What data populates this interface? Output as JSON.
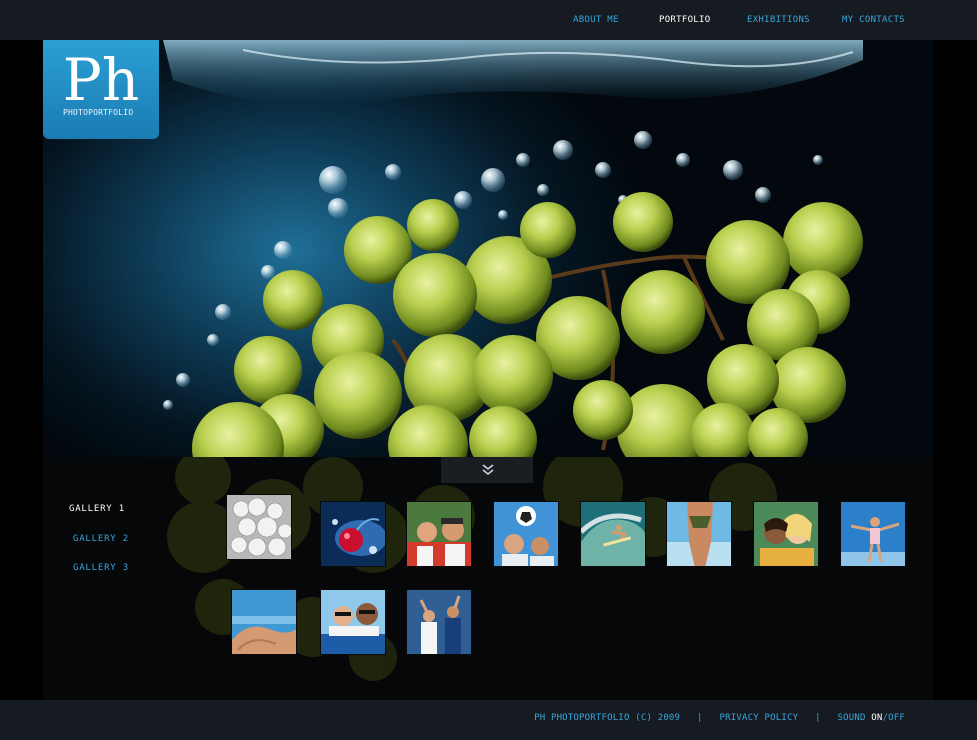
{
  "nav": {
    "items": [
      {
        "label": "ABOUT ME"
      },
      {
        "label": "PORTFOLIO"
      },
      {
        "label": "EXHIBITIONS"
      },
      {
        "label": "MY CONTACTS"
      }
    ],
    "active_label": "PORTFOLIO"
  },
  "logo": {
    "mark": "Ph",
    "subtitle": "PHOTOPORTFOLIO"
  },
  "gallery": {
    "links": [
      {
        "label": "GALLERY 1"
      },
      {
        "label": "GALLERY 2"
      },
      {
        "label": "GALLERY 3"
      }
    ],
    "active_label": "GALLERY 1"
  },
  "footer": {
    "copyright": "PH PHOTOPORTFOLIO  (C) 2009",
    "separator": "|",
    "privacy": "PRIVACY POLICY",
    "sound_label": "SOUND",
    "sound_on": "ON",
    "sound_slash": "/",
    "sound_off": "OFF"
  },
  "colors": {
    "accent": "#3aa6dd",
    "bar": "#161a21",
    "logo": "#2b9fd4"
  }
}
